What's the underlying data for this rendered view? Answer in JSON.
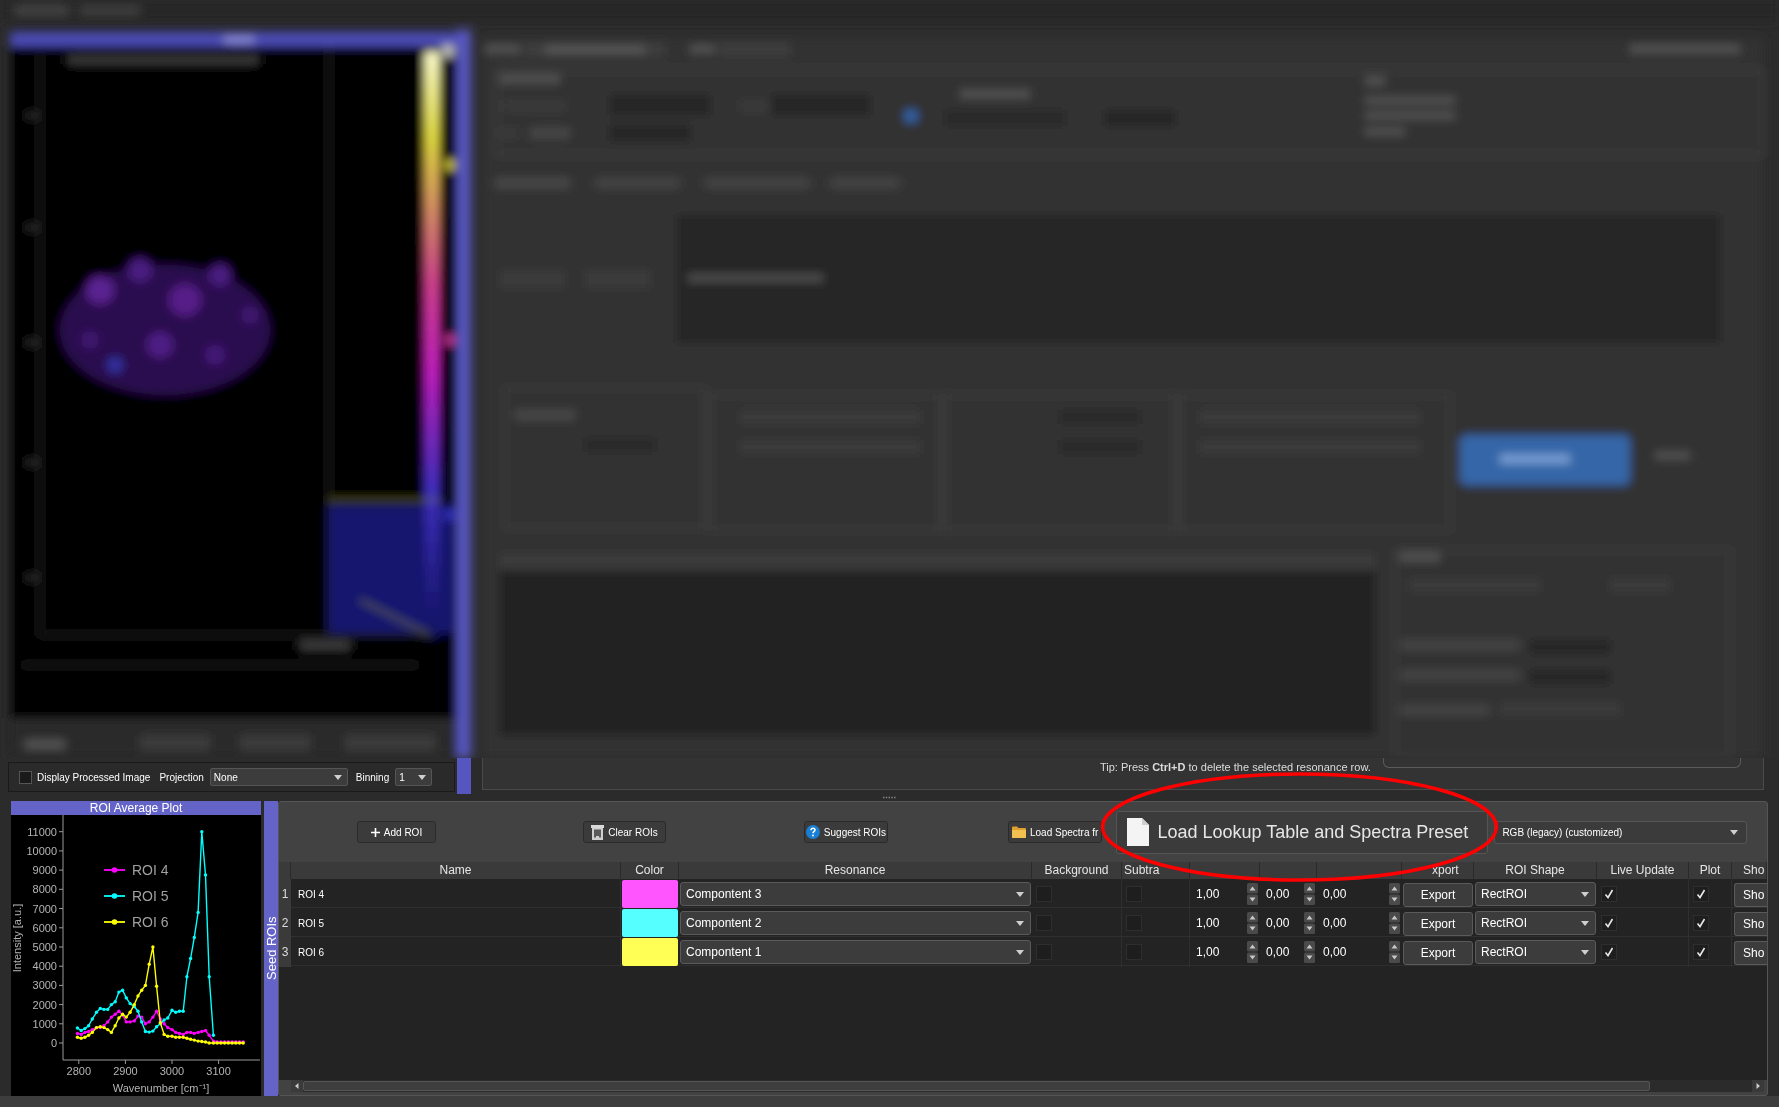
{
  "image_controls": {
    "display_processed": {
      "label": "Display Processed Image",
      "checked": false
    },
    "projection": {
      "label": "Projection",
      "value": "None"
    },
    "binning": {
      "label": "Binning",
      "value": "1"
    }
  },
  "tip": "Tip: Press **Ctrl+D** to delete the selected resonance row.",
  "plot": {
    "chart_data": {
      "type": "line",
      "title": "ROI Average Plot",
      "xlabel": "Wavenumber [cm⁻¹]",
      "ylabel": "Intensity [a.u.]",
      "legend": "upper left",
      "x": [
        2797,
        2805,
        2813,
        2821,
        2829,
        2838,
        2846,
        2854,
        2862,
        2870,
        2878,
        2886,
        2894,
        2902,
        2910,
        2919,
        2927,
        2935,
        2943,
        2951,
        2959,
        2967,
        2975,
        2983,
        2991,
        3000,
        3008,
        3016,
        3024,
        3032,
        3040,
        3048,
        3056,
        3064,
        3072,
        3080,
        3089,
        3097,
        3105,
        3113,
        3121,
        3129,
        3137,
        3145,
        3153
      ],
      "series": [
        {
          "name": "ROI 4",
          "color": "#ff00ff",
          "values": [
            500,
            450,
            550,
            600,
            700,
            800,
            800,
            900,
            1100,
            1350,
            1500,
            1650,
            1450,
            1100,
            1100,
            1150,
            1400,
            1350,
            1000,
            1100,
            1350,
            1650,
            1250,
            1000,
            800,
            700,
            550,
            500,
            450,
            550,
            550,
            500,
            550,
            600,
            650,
            400,
            100,
            50,
            50,
            50,
            50,
            50,
            50,
            50,
            50
          ]
        },
        {
          "name": "ROI 5",
          "color": "#00ffff",
          "values": [
            780,
            650,
            750,
            900,
            1250,
            1600,
            1800,
            1750,
            1750,
            2000,
            2150,
            2650,
            2750,
            2350,
            2050,
            1900,
            1650,
            1100,
            600,
            570,
            620,
            850,
            1000,
            1200,
            1300,
            1700,
            1600,
            1650,
            1650,
            3450,
            4400,
            5500,
            6800,
            11000,
            8750,
            3450,
            400,
            null,
            null,
            null,
            null,
            null,
            null,
            null,
            null
          ]
        },
        {
          "name": "ROI 6",
          "color": "#ffff00",
          "values": [
            300,
            250,
            300,
            400,
            550,
            800,
            850,
            800,
            700,
            550,
            900,
            1300,
            1500,
            1350,
            1600,
            2000,
            2450,
            2750,
            3000,
            4100,
            5000,
            2950,
            1050,
            450,
            350,
            350,
            300,
            300,
            300,
            250,
            200,
            150,
            100,
            80,
            50,
            0,
            0,
            0,
            0,
            0,
            0,
            0,
            0,
            0,
            0
          ]
        }
      ],
      "xlim": [
        2766,
        3189
      ],
      "ylim": [
        -885,
        11870
      ],
      "xticks": [
        2800,
        2900,
        3000,
        3100
      ],
      "yticks": [
        0,
        1000,
        2000,
        3000,
        4000,
        5000,
        6000,
        7000,
        8000,
        9000,
        10000,
        11000
      ]
    }
  },
  "side_tab": {
    "label": "Seed ROIs"
  },
  "toolbar": {
    "add_roi": "Add ROI",
    "clear_rois": "Clear ROIs",
    "suggest_rois": "Suggest ROIs",
    "load_spectra": "Load Spectra fr",
    "load_preset": "Load Lookup Table and Spectra Preset",
    "lookup_table": "RGB (legacy) (customized)"
  },
  "table": {
    "columns": [
      "Name",
      "Color",
      "Resonance",
      "Background",
      "Subtra",
      "xport",
      "ROI Shape",
      "Live Update",
      "Plot",
      "Sho"
    ],
    "rows": [
      {
        "number": "1",
        "name": "ROI 4",
        "color": "#ff55ff",
        "resonance": "Compontent 3",
        "background": false,
        "column_6": false,
        "column_7": "1,00",
        "column_8": "0,00",
        "column_9": "0,00",
        "export": "Export",
        "roi_shape": "RectROI",
        "live_update": true,
        "plot": true,
        "column_14": "Sho"
      },
      {
        "number": "2",
        "name": "ROI 5",
        "color": "#55ffff",
        "resonance": "Compontent 2",
        "background": false,
        "column_6": false,
        "column_7": "1,00",
        "column_8": "0,00",
        "column_9": "0,00",
        "export": "Export",
        "roi_shape": "RectROI",
        "live_update": true,
        "plot": true,
        "column_14": "Sho"
      },
      {
        "number": "3",
        "name": "ROI 6",
        "color": "#ffff55",
        "resonance": "Compontent 1",
        "background": false,
        "column_6": false,
        "column_7": "1,00",
        "column_8": "0,00",
        "column_9": "0,00",
        "export": "Export",
        "roi_shape": "RectROI",
        "live_update": true,
        "plot": true,
        "column_14": "Sho"
      }
    ]
  }
}
